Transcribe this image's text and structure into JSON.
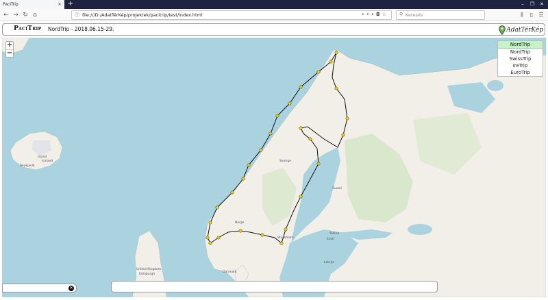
{
  "browser": {
    "tab_title": "PaciTrip",
    "tab_close": "×",
    "new_tab": "+",
    "url": "file:///D:/AdatTérKép/projektek/pacitrip/test/index.html",
    "search_placeholder": "Keresés",
    "window_controls": [
      "–",
      "❐",
      "✕"
    ],
    "nav_icons": [
      "arrow-left-icon",
      "arrow-right-icon",
      "reload-icon",
      "home-icon"
    ],
    "url_icons": [
      "page-actions-icon",
      "pocket-icon",
      "bookmark-star-icon"
    ],
    "toolbar_icons": [
      "library-icon",
      "sidebar-icon",
      "menu-icon"
    ]
  },
  "header": {
    "app_name": "PaciTrip",
    "trip_title": "NordTrip - 2018.06.15-29.",
    "brand": "AdatTérKép"
  },
  "map": {
    "zoom_in": "+",
    "zoom_out": "−",
    "trip_selector": {
      "selected": "NordTrip",
      "options": [
        "NordTrip",
        "SwissTrip",
        "IreTrip",
        "EuroTrip"
      ]
    },
    "labels": {
      "iceland": "Ísland",
      "iceland_en": "Iceland",
      "reykjavik": "Reykjavík",
      "norge": "Norge",
      "sverige": "Sverige",
      "suomi": "Suomi",
      "stockholm": "Stockholm",
      "tallinn": "Tallinn",
      "eesti": "Eesti",
      "latvija": "Latvija",
      "danmark": "Danmark",
      "uk": "United Kingdom",
      "edinburgh": "Edinburgh"
    },
    "info_close": "✕",
    "colors": {
      "water": "#aad3df",
      "land": "#f2efe9",
      "forest": "#cfe5c0",
      "route": "#111111",
      "marker": "#f0d000"
    }
  }
}
